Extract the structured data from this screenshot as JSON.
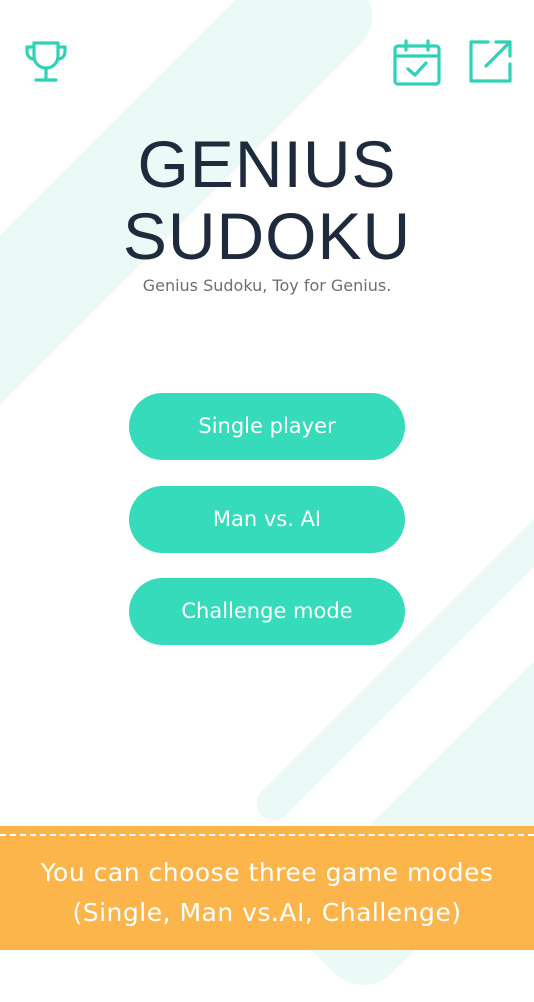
{
  "header": {
    "icons": [
      "trophy-icon",
      "calendar-check-icon",
      "share-icon"
    ]
  },
  "title": {
    "line1": "GENIUS",
    "line2": "SUDOKU",
    "subtitle": "Genius Sudoku, Toy for Genius."
  },
  "modes": [
    {
      "label": "Single player"
    },
    {
      "label": "Man vs. AI"
    },
    {
      "label": "Challenge mode"
    }
  ],
  "banner": {
    "line1": "You can choose three game modes",
    "line2": "(Single, Man vs.AI, Challenge)"
  },
  "colors": {
    "accent": "#36dbbb",
    "icon": "#2fd2b7",
    "title": "#1f2b3d",
    "banner": "#fbb54b"
  }
}
